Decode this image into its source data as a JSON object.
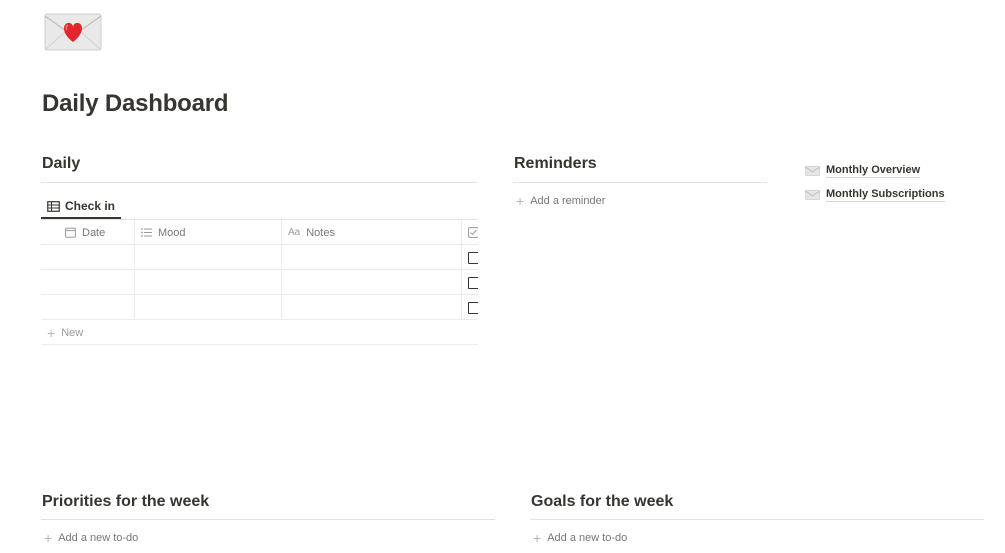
{
  "page": {
    "title": "Daily Dashboard",
    "icon": "love-letter-icon"
  },
  "daily": {
    "heading": "Daily",
    "view_tab": "Check in",
    "columns": [
      {
        "label": "Date",
        "icon": "calendar-icon"
      },
      {
        "label": "Mood",
        "icon": "list-icon"
      },
      {
        "label": "Notes",
        "icon": "text-icon"
      },
      {
        "label": "",
        "icon": "checkbox-icon"
      }
    ],
    "rows": [
      {
        "date": "",
        "mood": "",
        "notes": "",
        "checked": false
      },
      {
        "date": "",
        "mood": "",
        "notes": "",
        "checked": false
      },
      {
        "date": "",
        "mood": "",
        "notes": "",
        "checked": false
      }
    ],
    "new_label": "New"
  },
  "reminders": {
    "heading": "Reminders",
    "add_label": "Add a reminder"
  },
  "links": [
    {
      "label": "Monthly Overview",
      "icon": "envelope-icon"
    },
    {
      "label": "Monthly Subscriptions",
      "icon": "envelope-icon"
    }
  ],
  "priorities": {
    "heading": "Priorities for the week",
    "add_label": "Add a new to-do"
  },
  "goals": {
    "heading": "Goals for the week",
    "add_label": "Add a new to-do"
  }
}
